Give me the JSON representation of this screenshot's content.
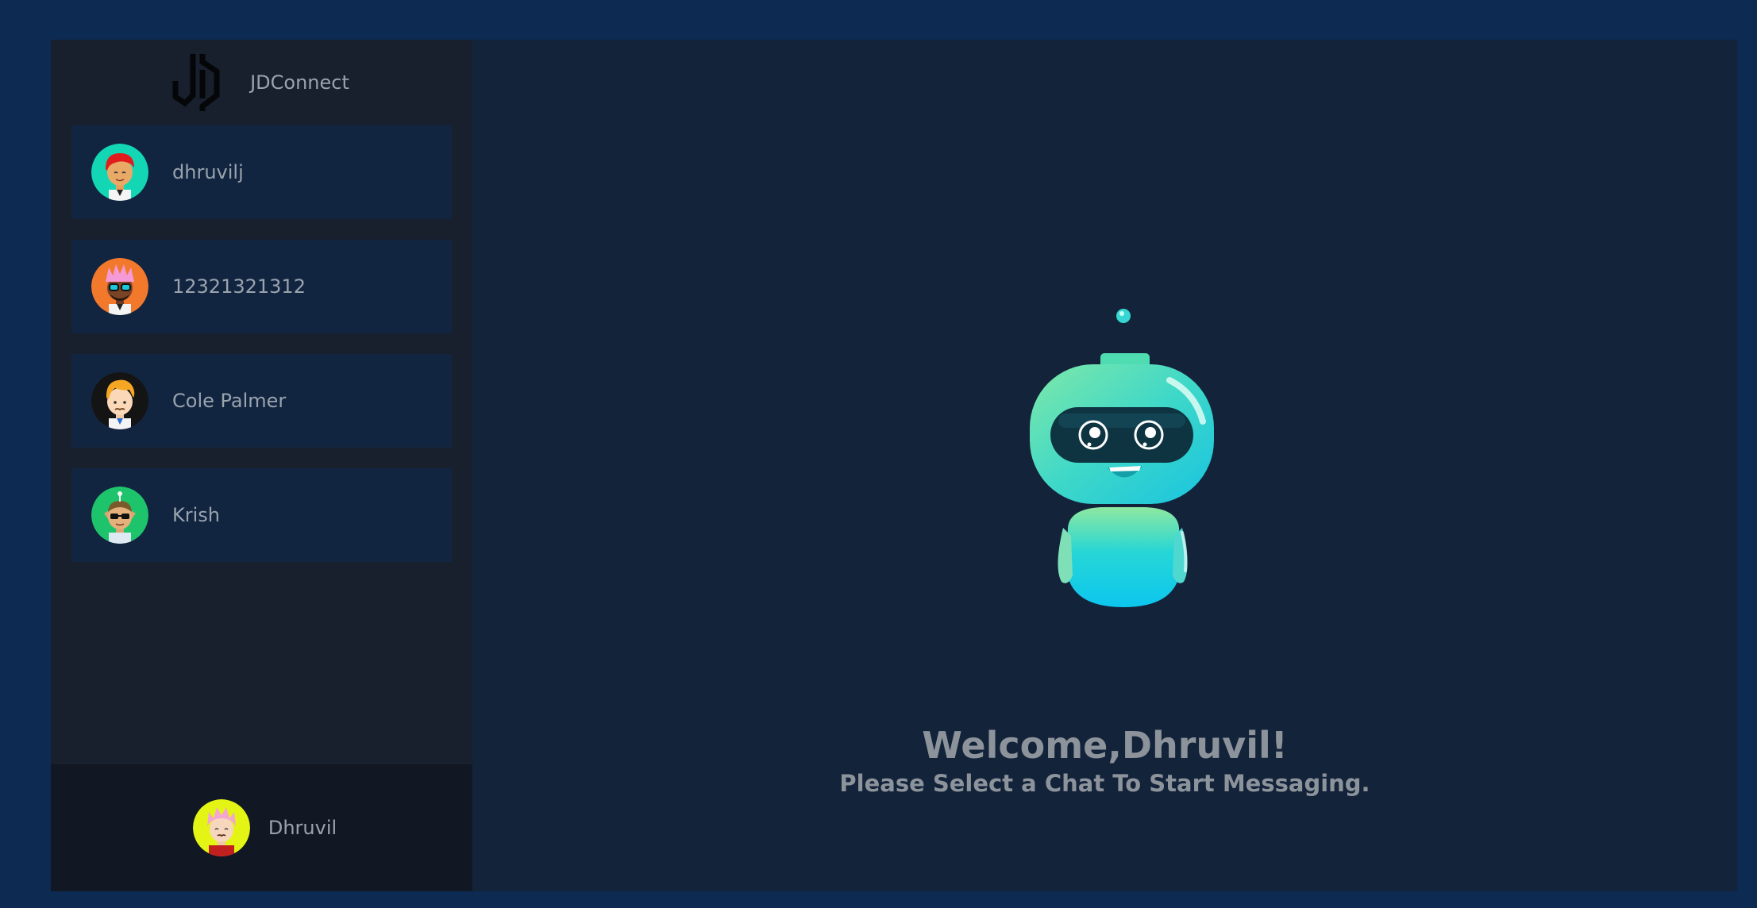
{
  "app": {
    "brand_name": "JDConnect"
  },
  "contacts": [
    {
      "name": "dhruvilj",
      "avatar": "avatar-red-hair"
    },
    {
      "name": "12321321312",
      "avatar": "avatar-pink-hair-sunglasses"
    },
    {
      "name": "Cole Palmer",
      "avatar": "avatar-orange-hair"
    },
    {
      "name": "Krish",
      "avatar": "avatar-sunglasses-green"
    }
  ],
  "current_user": {
    "name": "Dhruvil",
    "avatar": "avatar-pink-hair-yellow"
  },
  "welcome": {
    "title": "Welcome,Dhruvil!",
    "subtitle": "Please Select a Chat To Start Messaging."
  },
  "colors": {
    "page_background": "#0c2a52",
    "sidebar": "#181f2d",
    "contact_card": "#122540",
    "main_panel": "#13233a",
    "footer": "#111823",
    "text": "#9aa3ad"
  }
}
